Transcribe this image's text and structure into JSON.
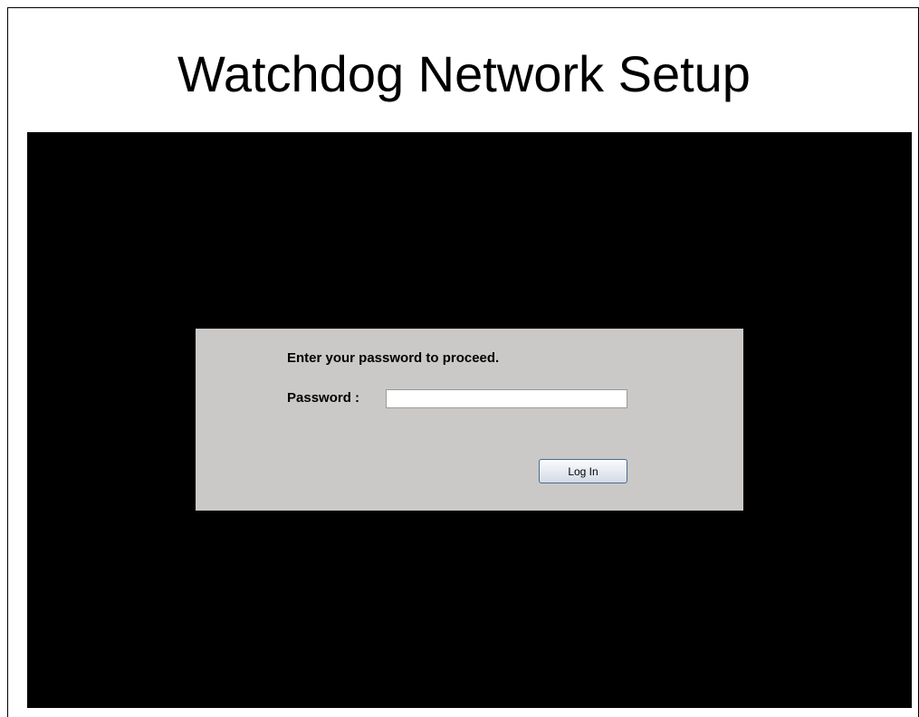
{
  "header": {
    "title": "Watchdog Network Setup"
  },
  "login": {
    "prompt": "Enter your password to proceed.",
    "password_label": "Password :",
    "password_value": "",
    "login_button": "Log In"
  },
  "colors": {
    "screen_background": "#000000",
    "panel_background": "#cbc9c7",
    "button_border": "#4a6a92"
  }
}
